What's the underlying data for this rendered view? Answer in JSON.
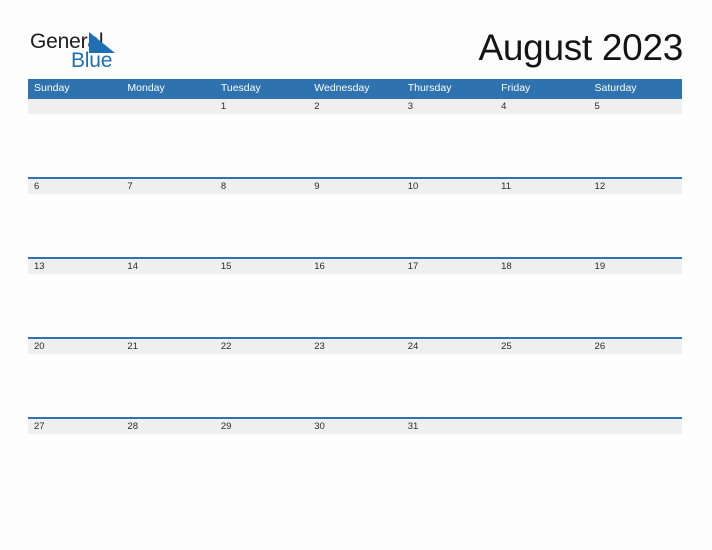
{
  "logo": {
    "word_top": "General",
    "word_bottom": "Blue",
    "triangle_icon": "blue-triangle-icon",
    "color_text": "#1c1c1c",
    "color_blue": "#1f6fb5"
  },
  "header": {
    "title": "August 2023"
  },
  "colors": {
    "header_blue": "#2e72b0",
    "band_gray": "#efefef",
    "page_background": "#fdfdfd",
    "date_text": "#2b2b2b",
    "weekday_text": "#ffffff"
  },
  "calendar": {
    "month": "August",
    "year": "2023",
    "weekday_headers": [
      "Sunday",
      "Monday",
      "Tuesday",
      "Wednesday",
      "Thursday",
      "Friday",
      "Saturday"
    ],
    "weeks": [
      {
        "days": [
          {
            "date": ""
          },
          {
            "date": ""
          },
          {
            "date": "1"
          },
          {
            "date": "2"
          },
          {
            "date": "3"
          },
          {
            "date": "4"
          },
          {
            "date": "5"
          }
        ]
      },
      {
        "days": [
          {
            "date": "6"
          },
          {
            "date": "7"
          },
          {
            "date": "8"
          },
          {
            "date": "9"
          },
          {
            "date": "10"
          },
          {
            "date": "11"
          },
          {
            "date": "12"
          }
        ]
      },
      {
        "days": [
          {
            "date": "13"
          },
          {
            "date": "14"
          },
          {
            "date": "15"
          },
          {
            "date": "16"
          },
          {
            "date": "17"
          },
          {
            "date": "18"
          },
          {
            "date": "19"
          }
        ]
      },
      {
        "days": [
          {
            "date": "20"
          },
          {
            "date": "21"
          },
          {
            "date": "22"
          },
          {
            "date": "23"
          },
          {
            "date": "24"
          },
          {
            "date": "25"
          },
          {
            "date": "26"
          }
        ]
      },
      {
        "days": [
          {
            "date": "27"
          },
          {
            "date": "28"
          },
          {
            "date": "29"
          },
          {
            "date": "30"
          },
          {
            "date": "31"
          },
          {
            "date": ""
          },
          {
            "date": ""
          }
        ]
      }
    ]
  }
}
